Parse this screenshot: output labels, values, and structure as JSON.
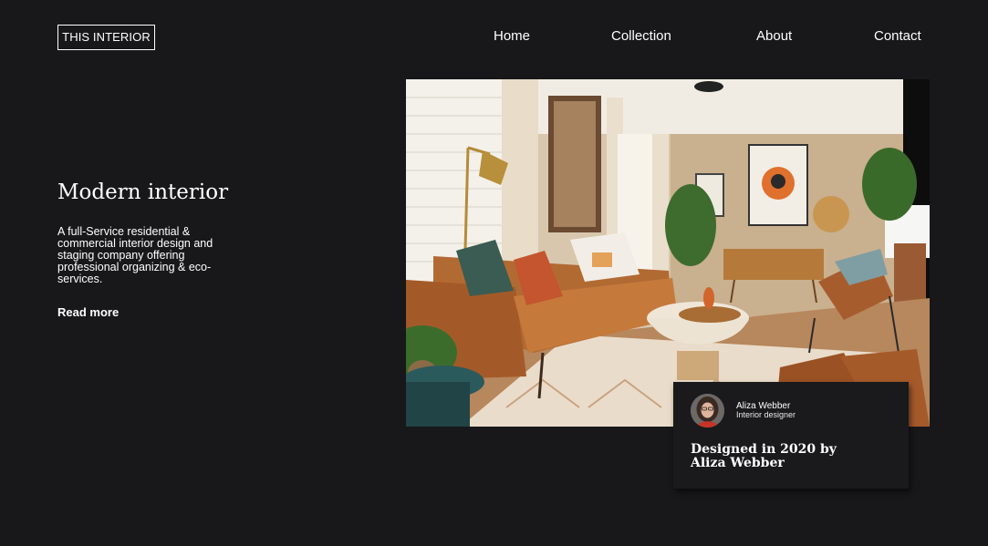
{
  "brand": {
    "logo_text": "THIS INTERIOR"
  },
  "nav": {
    "items": [
      {
        "label": "Home"
      },
      {
        "label": "Collection"
      },
      {
        "label": "About"
      },
      {
        "label": "Contact"
      }
    ]
  },
  "hero": {
    "title": "Modern interior",
    "description": "A full-Service residential & commercial interior design and staging company offering professional organizing & eco-services.",
    "read_more": "Read more"
  },
  "card": {
    "designer_name": "Aliza Webber",
    "designer_role": "Interior designer",
    "caption": "Designed in 2020 by Aliza Webber"
  },
  "colors": {
    "background": "#18181a",
    "text": "#ffffff"
  }
}
